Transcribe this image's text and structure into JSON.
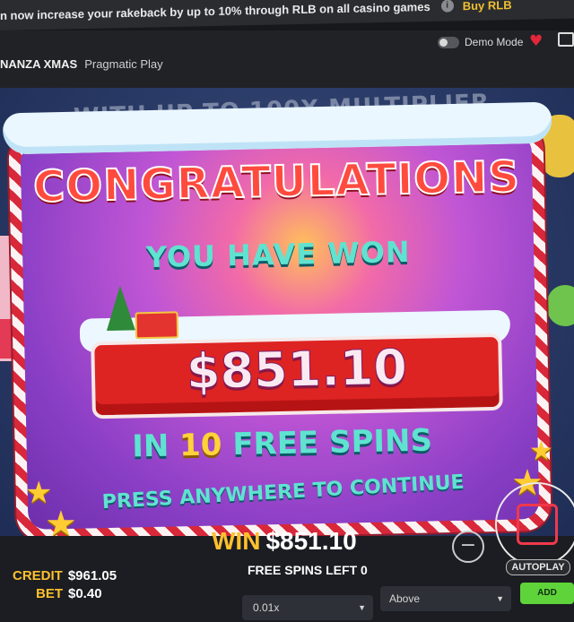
{
  "banner": {
    "text": "n now increase your rakeback by up to 10% through RLB on all casino games",
    "info_icon": "info-icon",
    "buy_label": "Buy RLB"
  },
  "header": {
    "game_title": "NANZA XMAS",
    "provider": "Pragmatic Play",
    "demo_mode_label": "Demo Mode"
  },
  "game": {
    "background_text": "WITH UP TO 100X MULTIPLIER",
    "popup": {
      "title": "CONGRATULATIONS",
      "subtitle": "YOU HAVE WON",
      "amount": "$851.10",
      "free_spins_prefix": "IN",
      "free_spins_number": "10",
      "free_spins_suffix": "FREE SPINS",
      "continue_text": "PRESS ANYWHERE TO CONTINUE"
    }
  },
  "footer": {
    "credit_label": "CREDIT",
    "credit_value": "$961.05",
    "bet_label": "BET",
    "bet_value": "$0.40",
    "win_label": "WIN",
    "win_value": "$851.10",
    "free_spins_left": "FREE SPINS LEFT 0",
    "autoplay_label": "AUTOPLAY"
  },
  "controls": {
    "multiplier_value": "0.01x",
    "condition_value": "Above",
    "add_label": "ADD"
  },
  "colors": {
    "accent_gold": "#ffc02d",
    "popup_teal": "#5fe3d0",
    "title_red": "#ff4b3e",
    "add_green": "#5fd33a"
  }
}
